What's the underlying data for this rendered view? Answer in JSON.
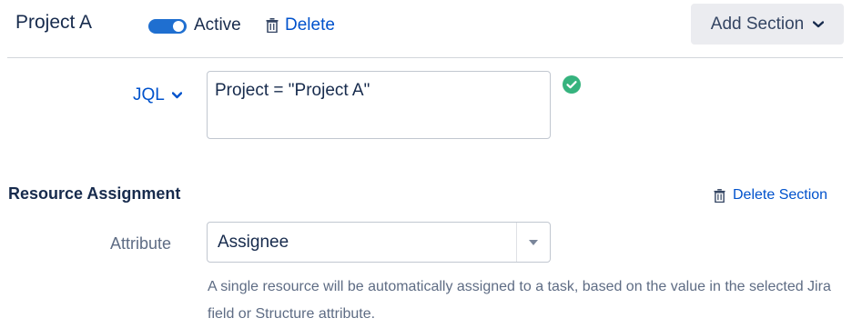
{
  "header": {
    "title": "Project A",
    "toggle_label": "Active",
    "toggle_on": true,
    "delete_label": "Delete",
    "add_section_label": "Add Section"
  },
  "jql": {
    "label": "JQL",
    "value": "Project = \"Project A\"",
    "status": "valid"
  },
  "resource_assignment": {
    "title": "Resource Assignment",
    "delete_section_label": "Delete Section",
    "attribute_label": "Attribute",
    "attribute_value": "Assignee",
    "help_text": "A single resource will be automatically assigned to a task, based on the value in the selected Jira field or Structure attribute."
  },
  "colors": {
    "link": "#0052cc",
    "toggle": "#1f6fd0",
    "success": "#36b37e",
    "button_bg": "#ebecf0"
  }
}
